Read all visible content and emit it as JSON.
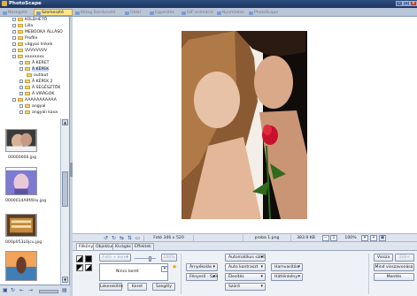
{
  "window": {
    "title": "PhotoScape"
  },
  "tabs": [
    {
      "label": "Nézegető",
      "active": false
    },
    {
      "label": "Szerkesztő",
      "active": true
    },
    {
      "label": "Köteg Szerkesztő",
      "active": false
    },
    {
      "label": "Oldal",
      "active": false
    },
    {
      "label": "Egyesítés",
      "active": false
    },
    {
      "label": "GIF animáció",
      "active": false
    },
    {
      "label": "Nyomtatás",
      "active": false
    },
    {
      "label": "PhotoScape",
      "active": false
    }
  ],
  "tree": {
    "items": [
      {
        "label": "KÜLDHETŐ",
        "type": "folder"
      },
      {
        "label": "Lilla",
        "type": "folder"
      },
      {
        "label": "MEBOOKA ÁLLÁSO",
        "type": "folder"
      },
      {
        "label": "Profile",
        "type": "folder"
      },
      {
        "label": "vágyos linkek",
        "type": "folder"
      },
      {
        "label": "VVVVVVVV",
        "type": "folder"
      },
      {
        "label": "xxxxxxxx",
        "type": "folder"
      },
      {
        "label": "Á KERET",
        "type": "folder"
      },
      {
        "label": "Á KÉPEK",
        "type": "folder"
      },
      {
        "label": "outlaut",
        "type": "folder"
      },
      {
        "label": "Á KÉPEK 2",
        "type": "folder"
      },
      {
        "label": "Á SEGÉSZTÖK",
        "type": "folder"
      },
      {
        "label": "Á VIRÁGOK",
        "type": "folder"
      },
      {
        "label": "AAAAAAAAAAA",
        "type": "folder"
      },
      {
        "label": "angyal",
        "type": "folder"
      },
      {
        "label": "angyali kava",
        "type": "folder"
      }
    ]
  },
  "thumbnails": [
    {
      "caption": "00000006.jpg"
    },
    {
      "caption": "0000014A9f4Hu.jpg"
    },
    {
      "caption": "000p053L0jcu.jpg"
    },
    {
      "caption": ""
    }
  ],
  "status": {
    "dimensions": "Fotó 346 x 520",
    "filename": "proba 1.png",
    "filesize": "383.9 KB",
    "zoom": "100%"
  },
  "editor_tabs": [
    {
      "label": "Főkönyv",
      "active": true
    },
    {
      "label": "Objektum",
      "active": false
    },
    {
      "label": "Kivágás",
      "active": false
    },
    {
      "label": "Effektek",
      "active": false
    }
  ],
  "editor": {
    "frame_label": "Fotó + keret",
    "opacity": "100%",
    "frame_select": "Nincs keret",
    "rounded_btn": "Lekerekítés",
    "frame_btn": "Keret",
    "margin_btn": "Szegély",
    "brightness_btn": "Árnyékolás",
    "color_btn": "Fényerő - Szín",
    "autolevel_btn": "Automatikus szint",
    "autocontrast_btn": "Auto kontraszt",
    "sharpen_btn": "Élesítés",
    "filter_btn": "Szűrő",
    "backlight_btn": "Hamvasítás",
    "film_btn": "Hátlénkény",
    "undo_btn": "Vissza",
    "redo_btn": "Előre",
    "undo_all_btn": "Mind visszavonása",
    "save_btn": "Mentés"
  },
  "colors": {
    "accent": "#ffe48a",
    "title_bar": "#1d3560",
    "rose": "#c8102e"
  }
}
